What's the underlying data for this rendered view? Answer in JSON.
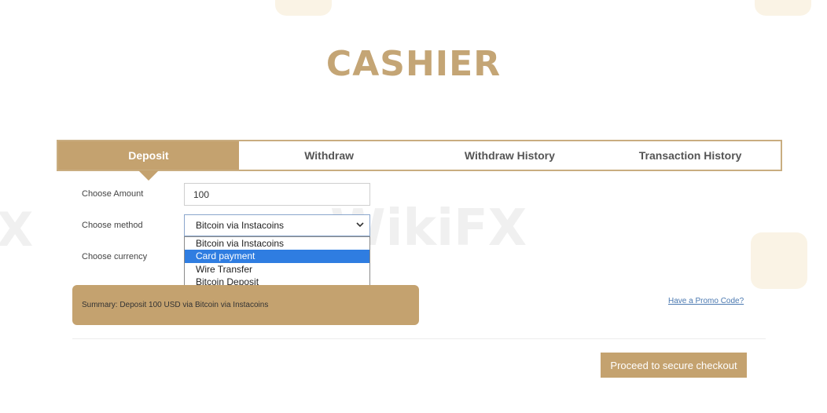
{
  "page": {
    "title": "CASHIER"
  },
  "tabs": [
    {
      "label": "Deposit",
      "active": true
    },
    {
      "label": "Withdraw",
      "active": false
    },
    {
      "label": "Withdraw History",
      "active": false
    },
    {
      "label": "Transaction History",
      "active": false
    }
  ],
  "form": {
    "amount_label": "Choose Amount",
    "amount_value": "100",
    "method_label": "Choose method",
    "method_selected": "Bitcoin via Instacoins",
    "method_options": [
      "Bitcoin via Instacoins",
      "Card payment",
      "Wire Transfer",
      "Bitcoin Deposit"
    ],
    "method_highlighted_index": 1,
    "currency_label": "Choose currency"
  },
  "summary": {
    "text": "Summary: Deposit 100 USD via Bitcoin via Instacoins"
  },
  "promo_link": "Have a Promo Code?",
  "checkout_button": "Proceed to secure checkout",
  "watermark": {
    "text": "WikiFX"
  },
  "colors": {
    "accent": "#c4a26f",
    "title": "#c4a575",
    "link": "#4a78b0",
    "highlight": "#2f7de1"
  }
}
